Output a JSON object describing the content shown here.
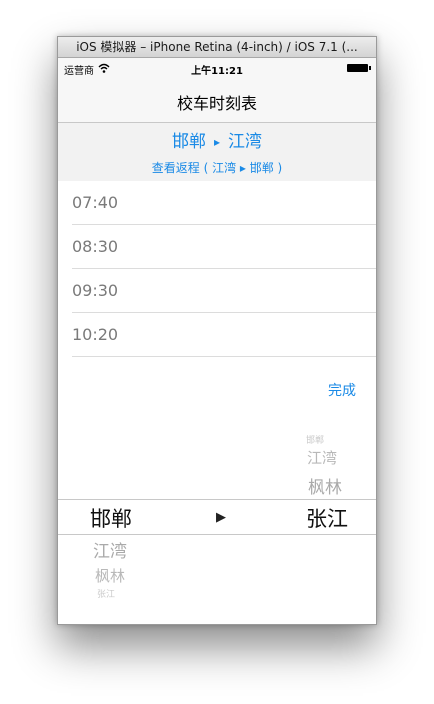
{
  "window": {
    "title": "iOS 模拟器 – iPhone Retina (4-inch) / iOS 7.1 (..."
  },
  "status_bar": {
    "carrier": "运营商",
    "time": "上午11:21"
  },
  "nav": {
    "title": "校车时刻表"
  },
  "route": {
    "from": "邯郸",
    "arrow": "▸",
    "to": "江湾",
    "return_link": "查看返程 ( 江湾 ▸ 邯郸 )"
  },
  "schedule": [
    "07:40",
    "08:30",
    "09:30",
    "10:20"
  ],
  "picker": {
    "done_label": "完成",
    "arrow": "▶",
    "left_column": {
      "selected": "邯郸",
      "below": [
        "江湾",
        "枫林",
        "张江"
      ]
    },
    "right_column": {
      "above": [
        "邯郸",
        "江湾",
        "枫林"
      ],
      "selected": "张江"
    }
  }
}
